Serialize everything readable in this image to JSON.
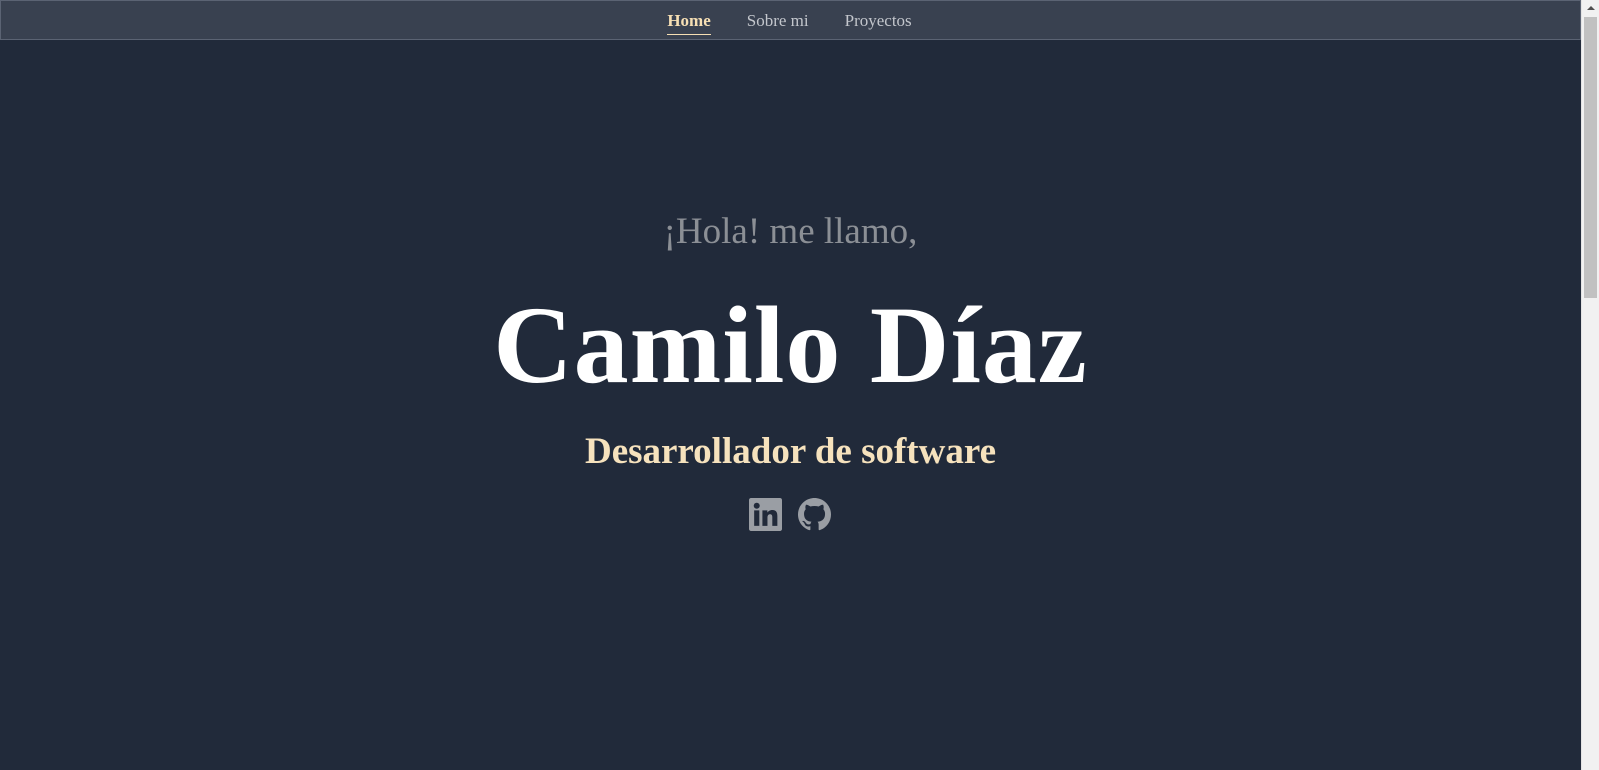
{
  "nav": {
    "items": [
      {
        "label": "Home",
        "active": true
      },
      {
        "label": "Sobre mi",
        "active": false
      },
      {
        "label": "Proyectos",
        "active": false
      }
    ]
  },
  "hero": {
    "greeting": "¡Hola! me llamo,",
    "name": "Camilo Díaz",
    "role": "Desarrollador de software"
  },
  "socials": [
    {
      "icon": "linkedin-icon"
    },
    {
      "icon": "github-icon"
    }
  ],
  "colors": {
    "background": "#212a3a",
    "navbar": "#394150",
    "accent": "#f6dfb4",
    "greeting": "#8b8f95",
    "icon": "#9a9ea4"
  }
}
